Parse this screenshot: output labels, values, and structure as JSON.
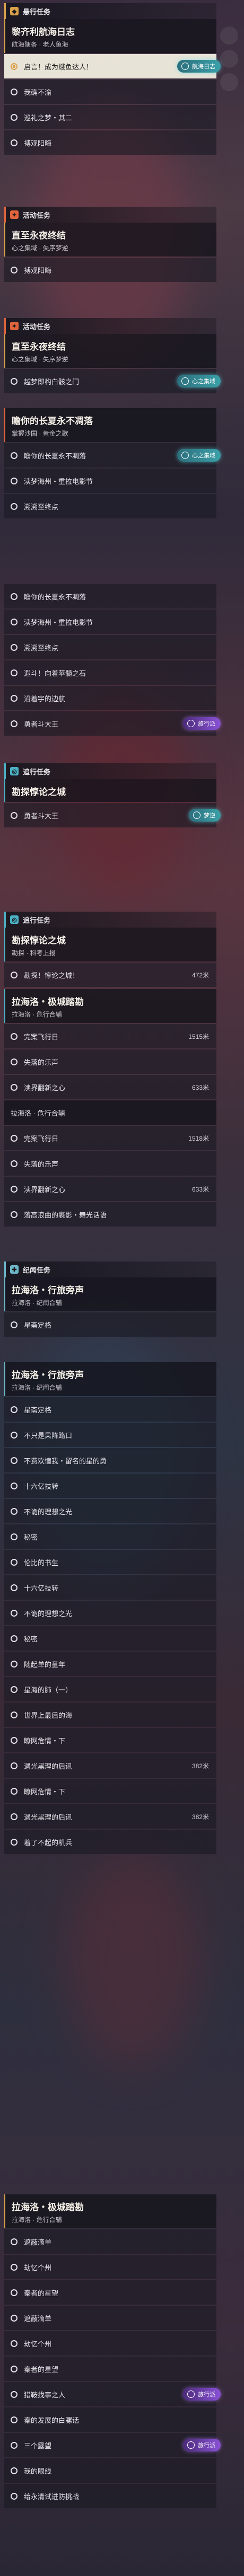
{
  "q1": {
    "title": "黎齐利航海日志",
    "sub": "航海随条 · 老人鱼海",
    "items": [
      "启言！成为蛾鱼达人！",
      "我确不渝",
      "巡礼之梦・其二",
      "搏观阳晦"
    ]
  },
  "cats": {
    "active": "活动任务",
    "trial": "悬行任务",
    "other": "纪闻任务",
    "tracking": "追行任务"
  },
  "q2": {
    "title": "直至永夜终结",
    "sub": "心之集域 · 失序梦逆",
    "items": [
      "搏观阳晦"
    ]
  },
  "q3": {
    "title": "直至永夜终结",
    "sub": "心之集域 · 失序梦逆",
    "items": [
      "越梦即构白骸之门"
    ]
  },
  "q4": {
    "title": "瞻你的长夏永不凋落",
    "sub": "掌握沙国 · 黄金之歌",
    "items": [
      "瞻你的长夏永不凋落",
      "渎梦海州・重拉电影节",
      "溯溯至终点",
      "遐斗！向着苹髓之石",
      "沿着宇的边航",
      "勇者斗大王"
    ]
  },
  "q5": {
    "title": "瞻你的长夏永不凋落",
    "sub": "",
    "items": [
      "瞻你的长夏永不凋落",
      "渎梦海州・重拉电影节",
      "溯溯至终点",
      "遐斗！向着苹髓之石",
      "沿着宇的边航",
      "勇者斗大王"
    ]
  },
  "q6": {
    "title": "勘探惇论之城",
    "sub": "",
    "items": [
      "勇者斗大王"
    ]
  },
  "q7": {
    "title": "勘探惇论之城",
    "sub": "勘探 · 科考上报",
    "items": [
      "勘探！惇论之城！"
    ],
    "dists": [
      "472米"
    ]
  },
  "q8": {
    "title": "拉海洛・极城踏勘",
    "sub": "拉海洛 · 危行合辅",
    "items": [
      "完案飞行日",
      "失落的乐声",
      "渎界翻新之心"
    ],
    "dists": [
      "1515米",
      "",
      "633米"
    ]
  },
  "q8b": {
    "items": [
      "拉海洛 · 危行合辅"
    ]
  },
  "q9": {
    "items": [
      "完案飞行日",
      "失落的乐声",
      "渎界翻新之心",
      "落高浪曲的裹影・舞光话语"
    ],
    "dists": [
      "1518米",
      "",
      "633米",
      ""
    ]
  },
  "q10": {
    "title": "拉海洛・行旅旁声",
    "sub": "拉海洛 · 纪闻合辅",
    "items": [
      "星斋定格"
    ]
  },
  "q11": {
    "title": "拉海洛・行旅旁声",
    "sub": "拉海洛 · 纪闻合辅",
    "items": [
      "星斋定格",
      "不只是果阵路口",
      "不费欢惶我・留名的星的勇",
      "十六亿技转",
      "不诡的理想之光",
      "秘密",
      "伦比的书生",
      "十六亿技转",
      "不诡的理想之光",
      "秘密",
      "随起单的童年",
      "星海的肺（一）",
      "世界上最后的海",
      "瞭网危情・下",
      "遇光黑理的后讯",
      "瞭网危情・下",
      "遇光黑理的后讯",
      "着了不起的机兵"
    ],
    "dists": [
      "",
      "",
      "",
      "",
      "",
      "",
      "",
      "",
      "",
      "",
      "",
      "",
      "",
      "",
      "382米",
      "",
      "382米",
      ""
    ]
  },
  "q12": {
    "title": "拉海洛・极城踏勘",
    "sub": "拉海洛 · 危行合辅",
    "items": [
      "遮蔽滴单",
      "劫忆个州",
      "秦者的星望",
      "遮蔽滴单",
      "劫忆个州",
      "秦者的星望",
      "猎鞍找事之人",
      "秦的发展的白骡话",
      "三个露望",
      "我的眼线",
      "给永清试进防挑战"
    ]
  },
  "badges": {
    "teal": "航海日志",
    "heart": "心之集域",
    "mind": "梦逆",
    "purple": "旅行派"
  }
}
